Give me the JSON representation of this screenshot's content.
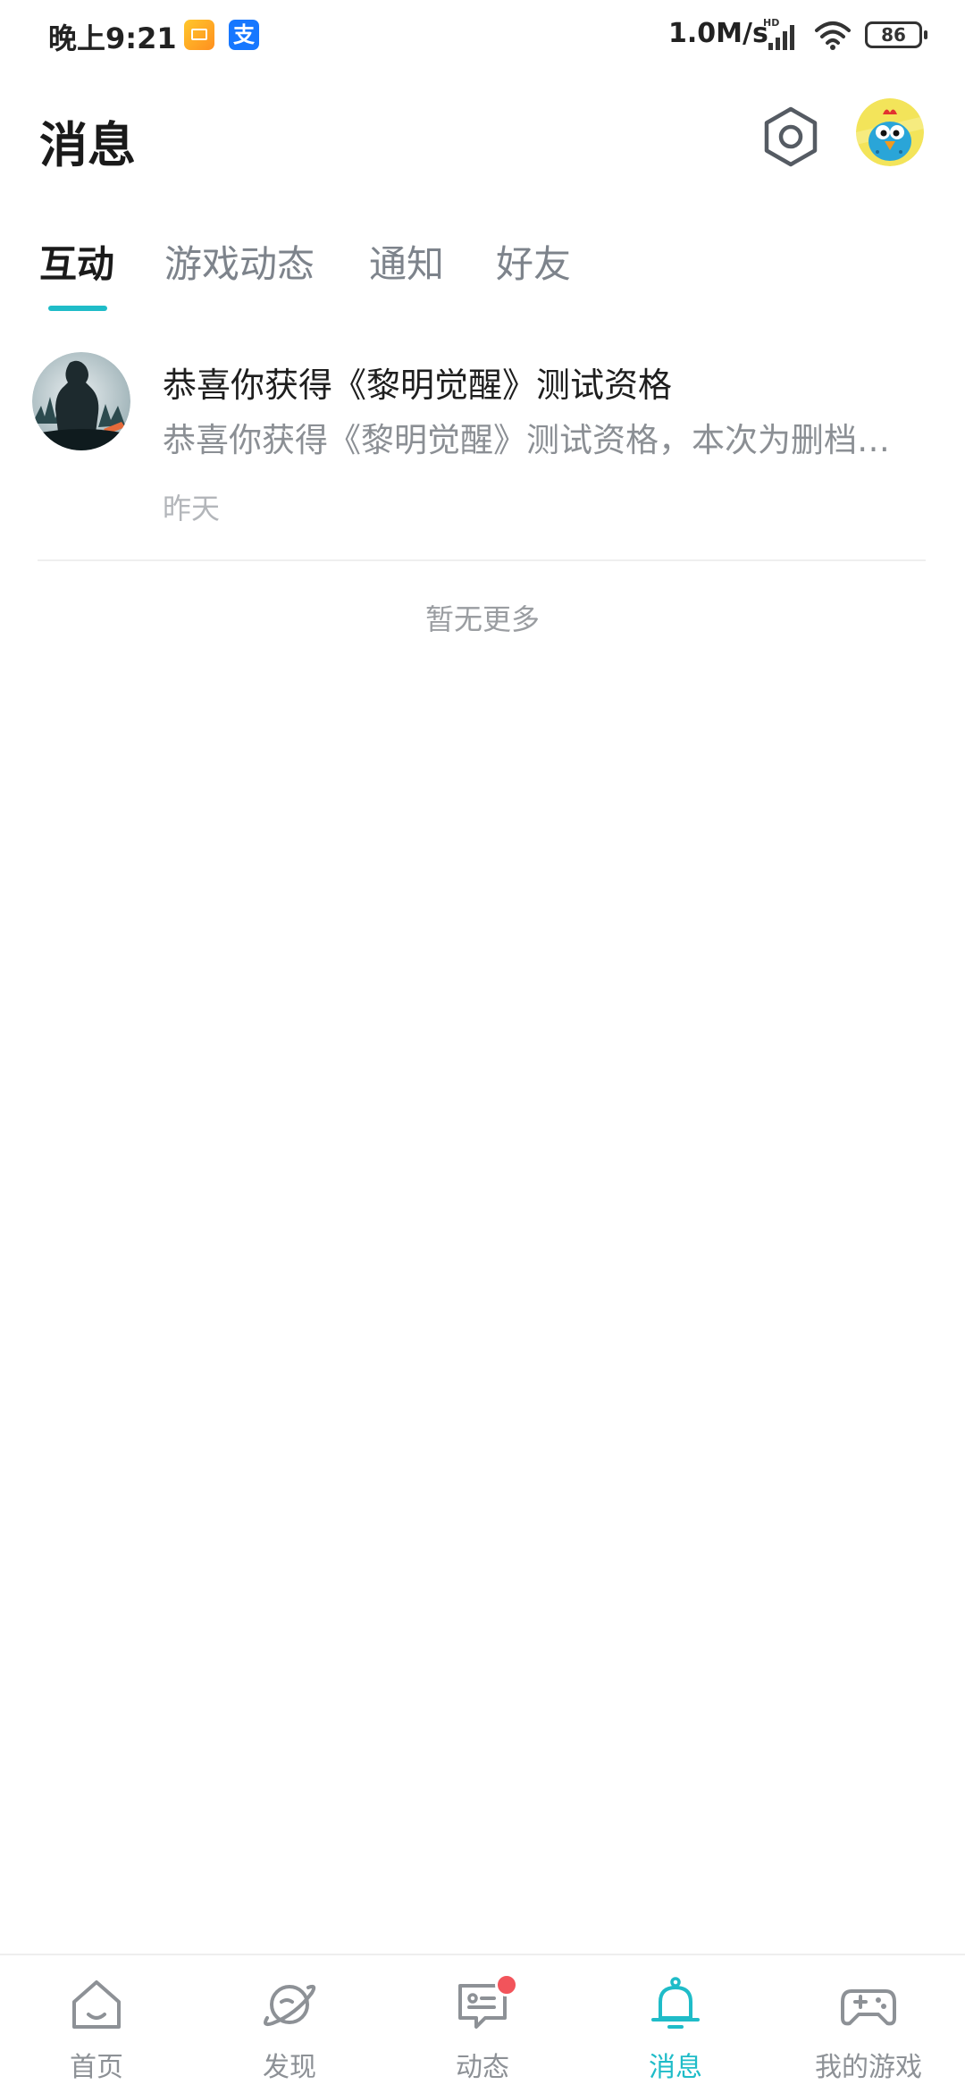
{
  "status_bar": {
    "time": "晚上9:21",
    "alipay_glyph": "支",
    "speed": "1.0M/s",
    "hd": "HD",
    "battery": "86",
    "icons": [
      "mail-app-icon",
      "alipay-icon",
      "signal-icon",
      "wifi-icon",
      "battery-icon"
    ]
  },
  "header": {
    "title": "消息",
    "settings_icon": "settings-hexagon-icon",
    "avatar_icon": "cartoon-bird-avatar"
  },
  "tabs": [
    {
      "label": "互动",
      "active": true
    },
    {
      "label": "游戏动态",
      "active": false
    },
    {
      "label": "通知",
      "active": false
    },
    {
      "label": "好友",
      "active": false
    }
  ],
  "messages": [
    {
      "title": "恭喜你获得《黎明觉醒》测试资格",
      "preview": "恭喜你获得《黎明觉醒》测试资格，本次为删档…",
      "time": "昨天",
      "avatar_icon": "game-silhouette-avatar"
    }
  ],
  "empty_text": "暂无更多",
  "bottom_nav": [
    {
      "label": "首页",
      "icon": "home-icon",
      "active": false
    },
    {
      "label": "发现",
      "icon": "planet-icon",
      "active": false
    },
    {
      "label": "动态",
      "icon": "chat-bubble-icon",
      "active": false,
      "badge": true
    },
    {
      "label": "消息",
      "icon": "bell-icon",
      "active": true
    },
    {
      "label": "我的游戏",
      "icon": "gamepad-icon",
      "active": false
    }
  ],
  "colors": {
    "accent": "#1fbcc8",
    "badge": "#f2545b",
    "text_primary": "#1a1a1a",
    "text_secondary": "#8b8f94"
  }
}
